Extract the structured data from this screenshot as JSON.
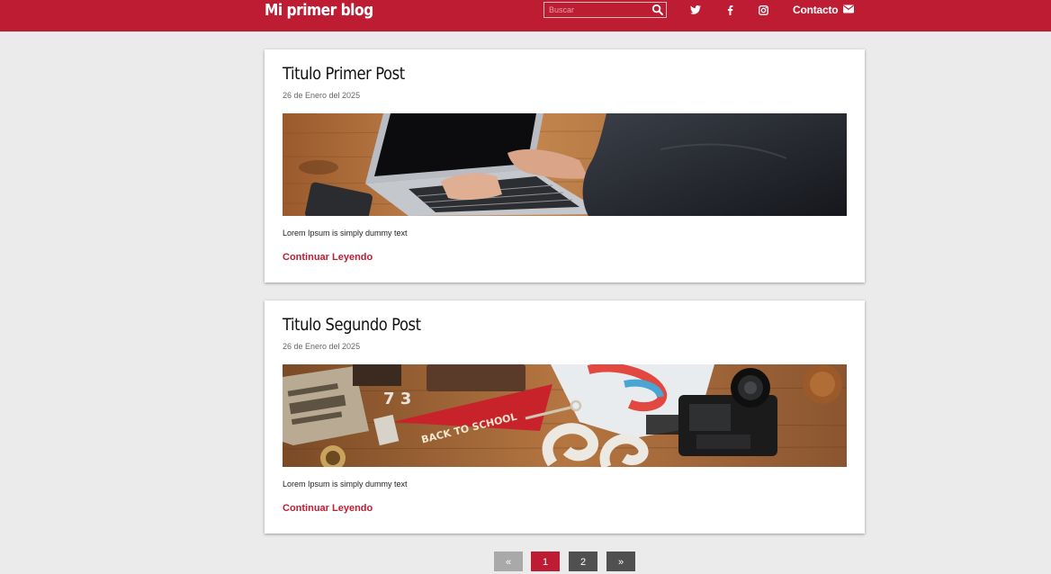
{
  "header": {
    "brand": "Mi primer blog",
    "search_placeholder": "Buscar",
    "contact_label": "Contacto",
    "social": [
      "twitter-icon",
      "facebook-icon",
      "instagram-icon"
    ],
    "accent_color": "#bd1c33"
  },
  "posts": [
    {
      "title": "Titulo Primer Post",
      "date": "26 de Enero del 2025",
      "excerpt": "Lorem Ipsum is simply dummy text",
      "read_more": "Continuar Leyendo",
      "image": "laptop-typing-photo"
    },
    {
      "title": "Titulo Segundo Post",
      "date": "26 de Enero del 2025",
      "excerpt": "Lorem Ipsum is simply dummy text",
      "read_more": "Continuar Leyendo",
      "image": "back-to-school-photo",
      "image_text": "BACK TO SCHOOL"
    }
  ],
  "pagination": {
    "prev": "«",
    "pages": [
      "1",
      "2"
    ],
    "next": "»",
    "current": "1"
  }
}
